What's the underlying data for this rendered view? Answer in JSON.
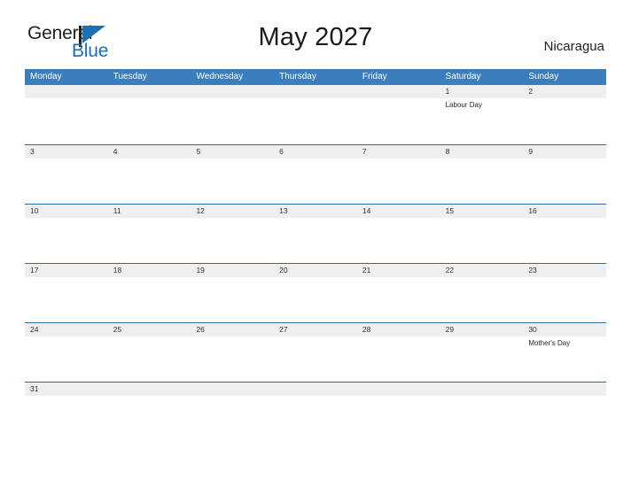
{
  "brand": {
    "name_part1": "General",
    "name_part2": "Blue",
    "flag_icon": "flag-triangle-icon",
    "accent_color": "#1a6fb5"
  },
  "header": {
    "title": "May 2027",
    "country": "Nicaragua"
  },
  "colors": {
    "header_blue": "#3a7ebd",
    "rule_blue": "#2e6da4",
    "band_gray": "#efefef"
  },
  "calendar": {
    "weekday_headers": [
      "Monday",
      "Tuesday",
      "Wednesday",
      "Thursday",
      "Friday",
      "Saturday",
      "Sunday"
    ],
    "weeks": [
      {
        "days": [
          {
            "number": "",
            "events": []
          },
          {
            "number": "",
            "events": []
          },
          {
            "number": "",
            "events": []
          },
          {
            "number": "",
            "events": []
          },
          {
            "number": "",
            "events": []
          },
          {
            "number": "1",
            "events": [
              "Labour Day"
            ]
          },
          {
            "number": "2",
            "events": []
          }
        ]
      },
      {
        "days": [
          {
            "number": "3",
            "events": []
          },
          {
            "number": "4",
            "events": []
          },
          {
            "number": "5",
            "events": []
          },
          {
            "number": "6",
            "events": []
          },
          {
            "number": "7",
            "events": []
          },
          {
            "number": "8",
            "events": []
          },
          {
            "number": "9",
            "events": []
          }
        ]
      },
      {
        "days": [
          {
            "number": "10",
            "events": []
          },
          {
            "number": "11",
            "events": []
          },
          {
            "number": "12",
            "events": []
          },
          {
            "number": "13",
            "events": []
          },
          {
            "number": "14",
            "events": []
          },
          {
            "number": "15",
            "events": []
          },
          {
            "number": "16",
            "events": []
          }
        ]
      },
      {
        "days": [
          {
            "number": "17",
            "events": []
          },
          {
            "number": "18",
            "events": []
          },
          {
            "number": "19",
            "events": []
          },
          {
            "number": "20",
            "events": []
          },
          {
            "number": "21",
            "events": []
          },
          {
            "number": "22",
            "events": []
          },
          {
            "number": "23",
            "events": []
          }
        ]
      },
      {
        "days": [
          {
            "number": "24",
            "events": []
          },
          {
            "number": "25",
            "events": []
          },
          {
            "number": "26",
            "events": []
          },
          {
            "number": "27",
            "events": []
          },
          {
            "number": "28",
            "events": []
          },
          {
            "number": "29",
            "events": []
          },
          {
            "number": "30",
            "events": [
              "Mother's Day"
            ]
          }
        ]
      },
      {
        "days": [
          {
            "number": "31",
            "events": []
          },
          {
            "number": "",
            "events": []
          },
          {
            "number": "",
            "events": []
          },
          {
            "number": "",
            "events": []
          },
          {
            "number": "",
            "events": []
          },
          {
            "number": "",
            "events": []
          },
          {
            "number": "",
            "events": []
          }
        ]
      }
    ]
  }
}
